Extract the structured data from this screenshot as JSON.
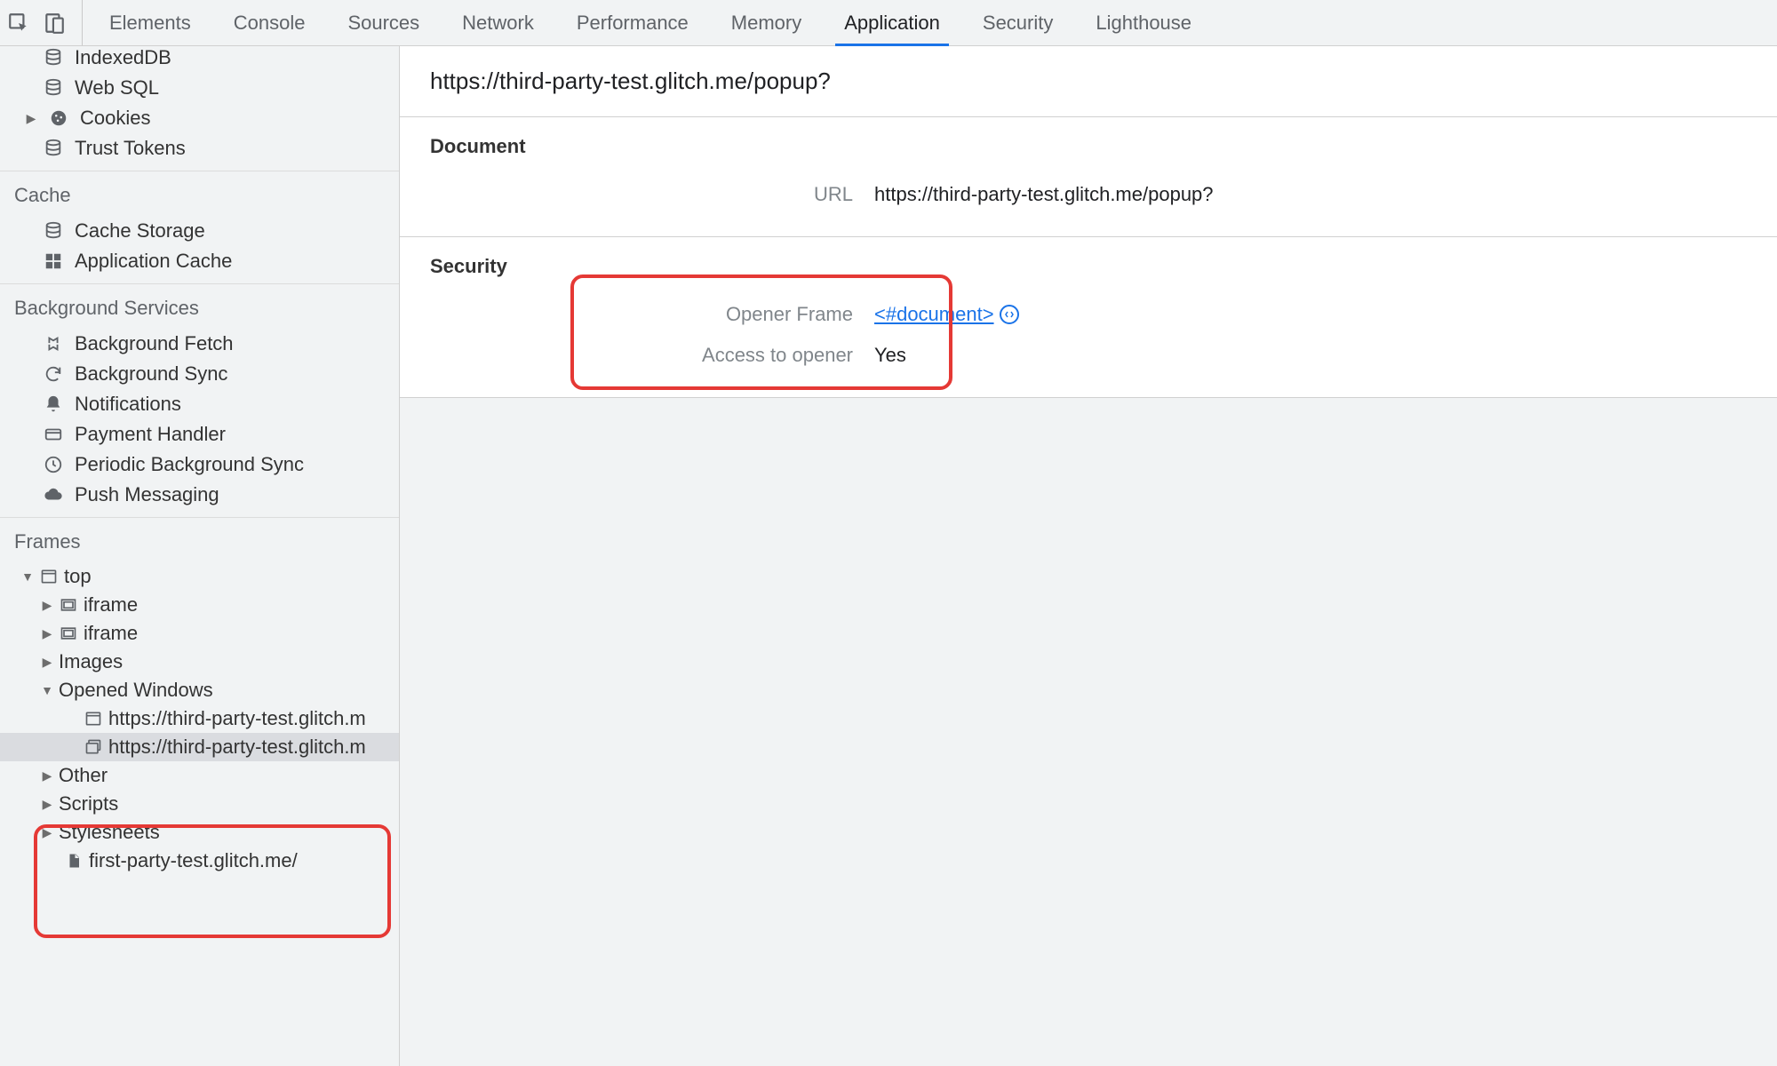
{
  "tabs": {
    "items": [
      "Elements",
      "Console",
      "Sources",
      "Network",
      "Performance",
      "Memory",
      "Application",
      "Security",
      "Lighthouse"
    ],
    "active": "Application"
  },
  "sidebar": {
    "storage_items": {
      "indexeddb": "IndexedDB",
      "websql": "Web SQL",
      "cookies": "Cookies",
      "trust_tokens": "Trust Tokens"
    },
    "cache": {
      "label": "Cache",
      "cache_storage": "Cache Storage",
      "app_cache": "Application Cache"
    },
    "bg": {
      "label": "Background Services",
      "fetch": "Background Fetch",
      "sync": "Background Sync",
      "notifications": "Notifications",
      "payment": "Payment Handler",
      "periodic": "Periodic Background Sync",
      "push": "Push Messaging"
    },
    "frames": {
      "label": "Frames",
      "top": "top",
      "iframe": "iframe",
      "images": "Images",
      "opened": "Opened Windows",
      "opened_item_1": "https://third-party-test.glitch.m",
      "opened_item_2": "https://third-party-test.glitch.m",
      "other": "Other",
      "scripts": "Scripts",
      "stylesheets": "Stylesheets",
      "first_party": "first-party-test.glitch.me/"
    }
  },
  "main": {
    "title": "https://third-party-test.glitch.me/popup?",
    "document": {
      "section": "Document",
      "url_label": "URL",
      "url_value": "https://third-party-test.glitch.me/popup?"
    },
    "security": {
      "section": "Security",
      "opener_label": "Opener Frame",
      "opener_value": "<#document>",
      "access_label": "Access to opener",
      "access_value": "Yes"
    }
  }
}
